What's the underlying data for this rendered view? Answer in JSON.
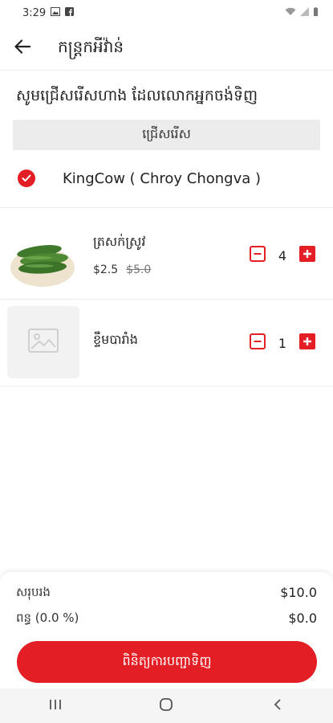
{
  "status_bar": {
    "time": "3:29"
  },
  "app_bar": {
    "title": "កន្ត្រកអីវ៉ាន់"
  },
  "prompt": "សូមជ្រើសរើសហាង ដែលលោកអ្នកចង់ទិញ",
  "select_button_label": "ជ្រើសរើស",
  "store": {
    "name": "KingCow ( Chroy Chongva )",
    "selected": true
  },
  "items": [
    {
      "name": "ត្រសក់ស្រូវ",
      "price": "$2.5",
      "old_price": "$5.0",
      "quantity": "4"
    },
    {
      "name": "ខ្ទឹមបារាំង",
      "price": "",
      "old_price": "",
      "quantity": "1"
    }
  ],
  "summary": {
    "subtotal_label": "សរុបរង",
    "subtotal_value": "$10.0",
    "tax_label": "ពន្ធ (0.0 %)",
    "tax_value": "$0.0",
    "checkout_label": "ពិនិត្យការបញ្ជាទិញ"
  },
  "colors": {
    "accent": "#e31e24"
  }
}
